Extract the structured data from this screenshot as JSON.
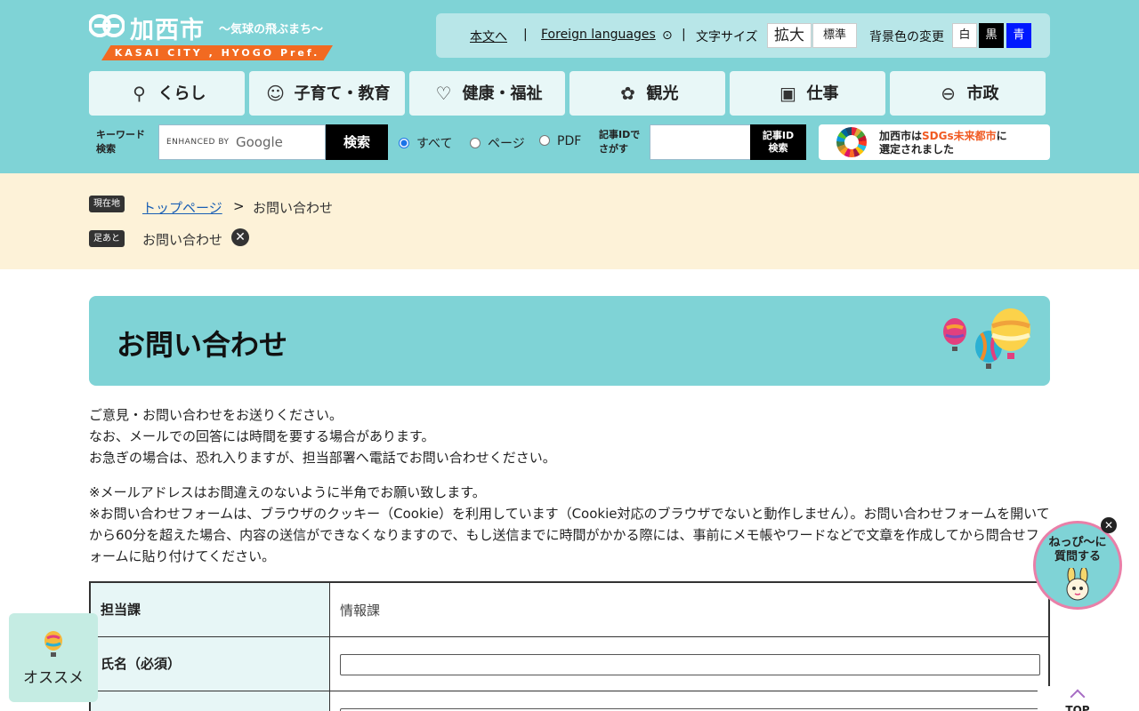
{
  "header": {
    "logo_name": "加西市",
    "logo_tagline": "〜気球の飛ぶまち〜",
    "logo_band": "KASAI CITY , HYOGO Pref."
  },
  "util": {
    "honbun": "本文へ",
    "foreign": "Foreign languages",
    "fontsize_label": "文字サイズ",
    "fontsize_large": "拡大",
    "fontsize_normal": "標準",
    "bg_label": "背景色の変更",
    "bg_white": "白",
    "bg_black": "黒",
    "bg_blue": "青"
  },
  "nav": {
    "items": [
      {
        "label": "くらし"
      },
      {
        "label": "子育て・教育"
      },
      {
        "label": "健康・福祉"
      },
      {
        "label": "観光"
      },
      {
        "label": "仕事"
      },
      {
        "label": "市政"
      }
    ]
  },
  "search": {
    "keyword_label_1": "キーワード",
    "keyword_label_2": "検索",
    "enhanced": "ENHANCED BY",
    "google": "Google",
    "button": "検索",
    "radio_all": "すべて",
    "radio_page": "ページ",
    "radio_pdf": "PDF",
    "id_label_1": "記事IDで",
    "id_label_2": "さがす",
    "id_button_1": "記事ID",
    "id_button_2": "検索"
  },
  "sdgs": {
    "line1_a": "加西市は",
    "line1_hl": "SDGs未来都市",
    "line1_b": "に",
    "line2": "選定されました"
  },
  "breadcrumb": {
    "current_badge": "現在地",
    "top_link": "トップページ",
    "gt": ">",
    "current": "お問い合わせ",
    "history_badge": "足あと",
    "history_item": "お問い合わせ"
  },
  "page": {
    "title": "お問い合わせ",
    "intro": [
      "ご意見・お問い合わせをお送りください。",
      "なお、メールでの回答には時間を要する場合があります。",
      "お急ぎの場合は、恐れ入りますが、担当部署へ電話でお問い合わせください。"
    ],
    "notes": [
      "※メールアドレスはお間違えのないように半角でお願い致します。",
      "※お問い合わせフォームは、ブラウザのクッキー（Cookie）を利用しています（Cookie対応のブラウザでないと動作しません）。お問い合わせフォームを開いてから60分を超えた場合、内容の送信ができなくなりますので、もし送信までに時間がかかる際には、事前にメモ帳やワードなどで文章を作成してから問合せフォームに貼り付けてください。"
    ]
  },
  "form": {
    "dept_label": "担当課",
    "dept_value": "情報課",
    "name_label": "氏名（必須）"
  },
  "floaters": {
    "osusume": "オススメ",
    "chat_line1": "ねっぴ〜に",
    "chat_line2": "質問する",
    "totop": "TOP"
  },
  "colors": {
    "header_bg": "#7fd3d6",
    "crumb_bg": "#fdf2d8",
    "accent_orange": "#f26a21"
  }
}
